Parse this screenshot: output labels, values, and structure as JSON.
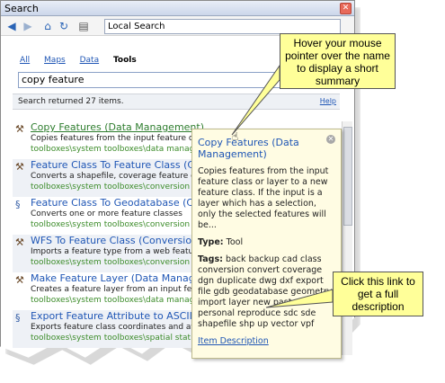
{
  "window": {
    "title": "Search"
  },
  "toolbar": {
    "back_icon": "back-arrow-icon",
    "forward_icon": "forward-arrow-icon",
    "home_icon": "home-icon",
    "refresh_icon": "refresh-icon",
    "index_icon": "index-options-icon",
    "location": "Local Search"
  },
  "tabs": [
    {
      "label": "All"
    },
    {
      "label": "Maps"
    },
    {
      "label": "Data"
    },
    {
      "label": "Tools"
    }
  ],
  "search": {
    "value": "copy feature"
  },
  "status": {
    "text": "Search returned 27 items.",
    "help": "Help"
  },
  "results": [
    {
      "icon": "hammer-icon",
      "name": "Copy Features (Data Management)",
      "desc": "Copies features from the input feature class or layer",
      "path": "toolboxes\\system toolboxes\\data management tools.tbx"
    },
    {
      "icon": "hammer-icon",
      "name": "Feature Class To Feature Class (Conversion)",
      "desc": "Converts a shapefile, coverage feature class",
      "path": "toolboxes\\system toolboxes\\conversion tools.tbx"
    },
    {
      "icon": "script-icon",
      "name": "Feature Class To Geodatabase (Conversion)",
      "desc": "Converts one or more feature classes",
      "path": "toolboxes\\system toolboxes\\conversion tools.tbx"
    },
    {
      "icon": "hammer-icon",
      "name": "WFS To Feature Class (Conversion)",
      "desc": "Imports a feature type from a web feature service",
      "path": "toolboxes\\system toolboxes\\conversion tools.tbx"
    },
    {
      "icon": "hammer-icon",
      "name": "Make Feature Layer (Data Management)",
      "desc": "Creates a feature layer from an input feature class",
      "path": "toolboxes\\system toolboxes\\data management tools.tbx"
    },
    {
      "icon": "script-icon",
      "name": "Export Feature Attribute to ASCII (Spatial Statistics)",
      "desc": "Exports feature class coordinates and attribute values",
      "path": "toolboxes\\system toolboxes\\spatial statistics tools.tbx\\utilities\\export feature"
    }
  ],
  "popup": {
    "title": "Copy Features (Data Management)",
    "body": "Copies features from the input feature class or layer to a new feature class. If the input is a layer which has a selection, only the selected features will be...",
    "type_label": "Type:",
    "type_value": "Tool",
    "tags_label": "Tags:",
    "tags_value": "back backup cad class conversion convert coverage dgn duplicate dwg dxf export file gdb geodatabase geometry import layer new paste personal reproduce sdc sde shapefile shp up vector vpf",
    "link": "Item Description"
  },
  "callouts": {
    "hover": "Hover your mouse pointer over the name to display a short summary",
    "link": "Click this link to get a full description"
  },
  "colors": {
    "link": "#1f56b5",
    "path": "#3c8c2a",
    "callout": "#ffff99",
    "popup": "#fffce3"
  }
}
